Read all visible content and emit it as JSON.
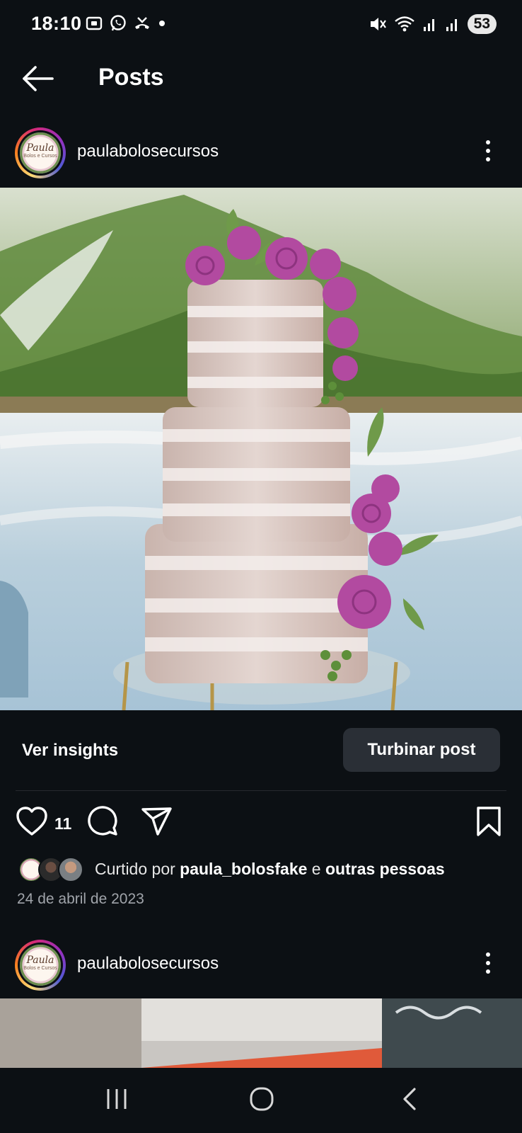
{
  "status_bar": {
    "time": "18:10",
    "left_icons": [
      "screenshot-icon",
      "whatsapp-icon",
      "missed-call-icon",
      "dot-icon"
    ],
    "right_icons": [
      "mute-icon",
      "wifi-icon",
      "signal-icon",
      "signal-icon"
    ],
    "battery": "53"
  },
  "header": {
    "title": "Posts",
    "back_icon": "arrow-left-icon"
  },
  "posts": [
    {
      "username": "paulabolosecursos",
      "avatar_text": "Paula",
      "avatar_subtext": "Bolos e Cursos",
      "photo_alt": "three-tier semi-naked cake with purple roses",
      "insights_label": "Ver insights",
      "boost_label": "Turbinar post",
      "like_count": "11",
      "liked_by_prefix": "Curtido por",
      "liked_by_user": "paula_bolosfake",
      "liked_by_joiner": "e",
      "liked_by_others": "outras pessoas",
      "date": "24 de abril de 2023"
    },
    {
      "username": "paulabolosecursos",
      "avatar_text": "Paula",
      "avatar_subtext": "Bolos e Cursos"
    }
  ],
  "nav": {
    "recents": "recents-icon",
    "home": "home-icon",
    "back": "back-icon"
  },
  "colors": {
    "background": "#0c1014",
    "button_bg": "#2a2f36",
    "muted_text": "#a0a4aa"
  }
}
